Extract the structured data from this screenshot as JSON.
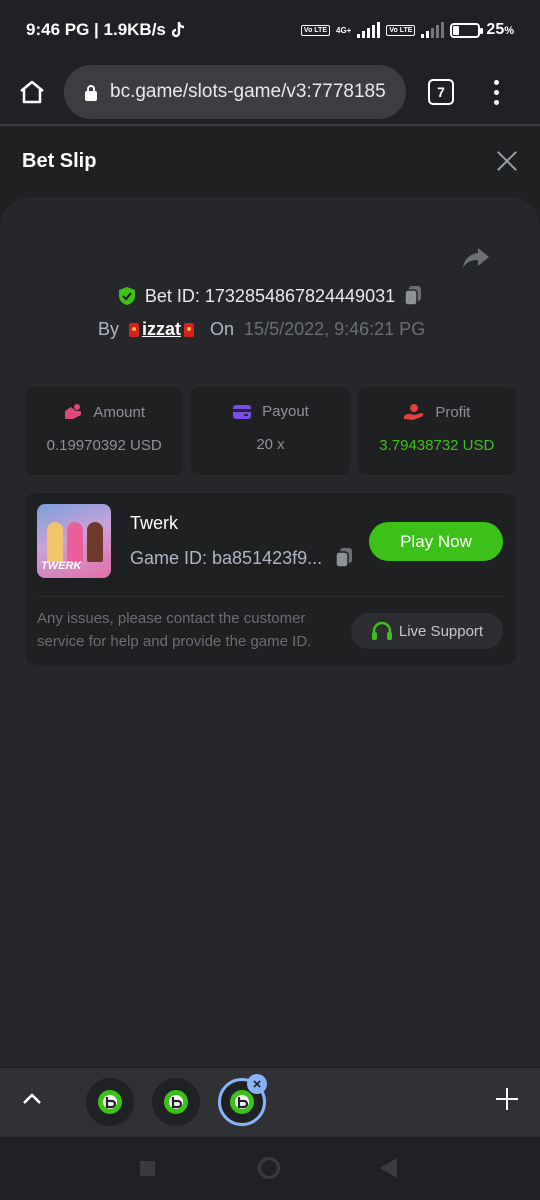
{
  "status_bar": {
    "time_speed": "9:46 PG | 1.9KB/s",
    "network": "4G+",
    "volte": "Vo LTE",
    "battery_percent": "25",
    "battery_suffix": "%",
    "battery_level": 0.25
  },
  "browser": {
    "url": "bc.game/slots-game/v3:7778185",
    "tab_count": "7"
  },
  "bet_slip": {
    "title": "Bet Slip",
    "bet_id_label": "Bet ID: 1732854867824449031",
    "by_label": "By",
    "username": "izzat",
    "on_label": "On",
    "date": "15/5/2022, 9:46:21 PG",
    "stats": {
      "amount": {
        "label": "Amount",
        "value": "0.19970392 USD"
      },
      "payout": {
        "label": "Payout",
        "value": "20 x"
      },
      "profit": {
        "label": "Profit",
        "value": "3.79438732 USD"
      }
    },
    "game": {
      "name": "Twerk",
      "thumb_text": "TWERK",
      "game_id": "Game ID: ba851423f9...",
      "play_label": "Play Now",
      "issues_text": "Any issues, please contact the customer service for help and provide the game ID.",
      "support_label": "Live Support"
    }
  },
  "colors": {
    "accent_green": "#3bc117",
    "tab_active": "#8ab4f8"
  }
}
